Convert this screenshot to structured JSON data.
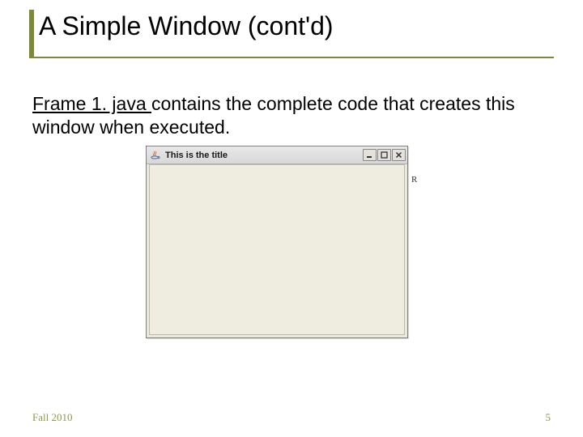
{
  "title": "A Simple Window (cont'd)",
  "body": {
    "link_text": "Frame 1. java ",
    "rest_text": "contains the complete code that creates this window when executed."
  },
  "java_window": {
    "title": "This is the title"
  },
  "stray": "R",
  "footer": {
    "left": "Fall 2010",
    "right": "5"
  }
}
